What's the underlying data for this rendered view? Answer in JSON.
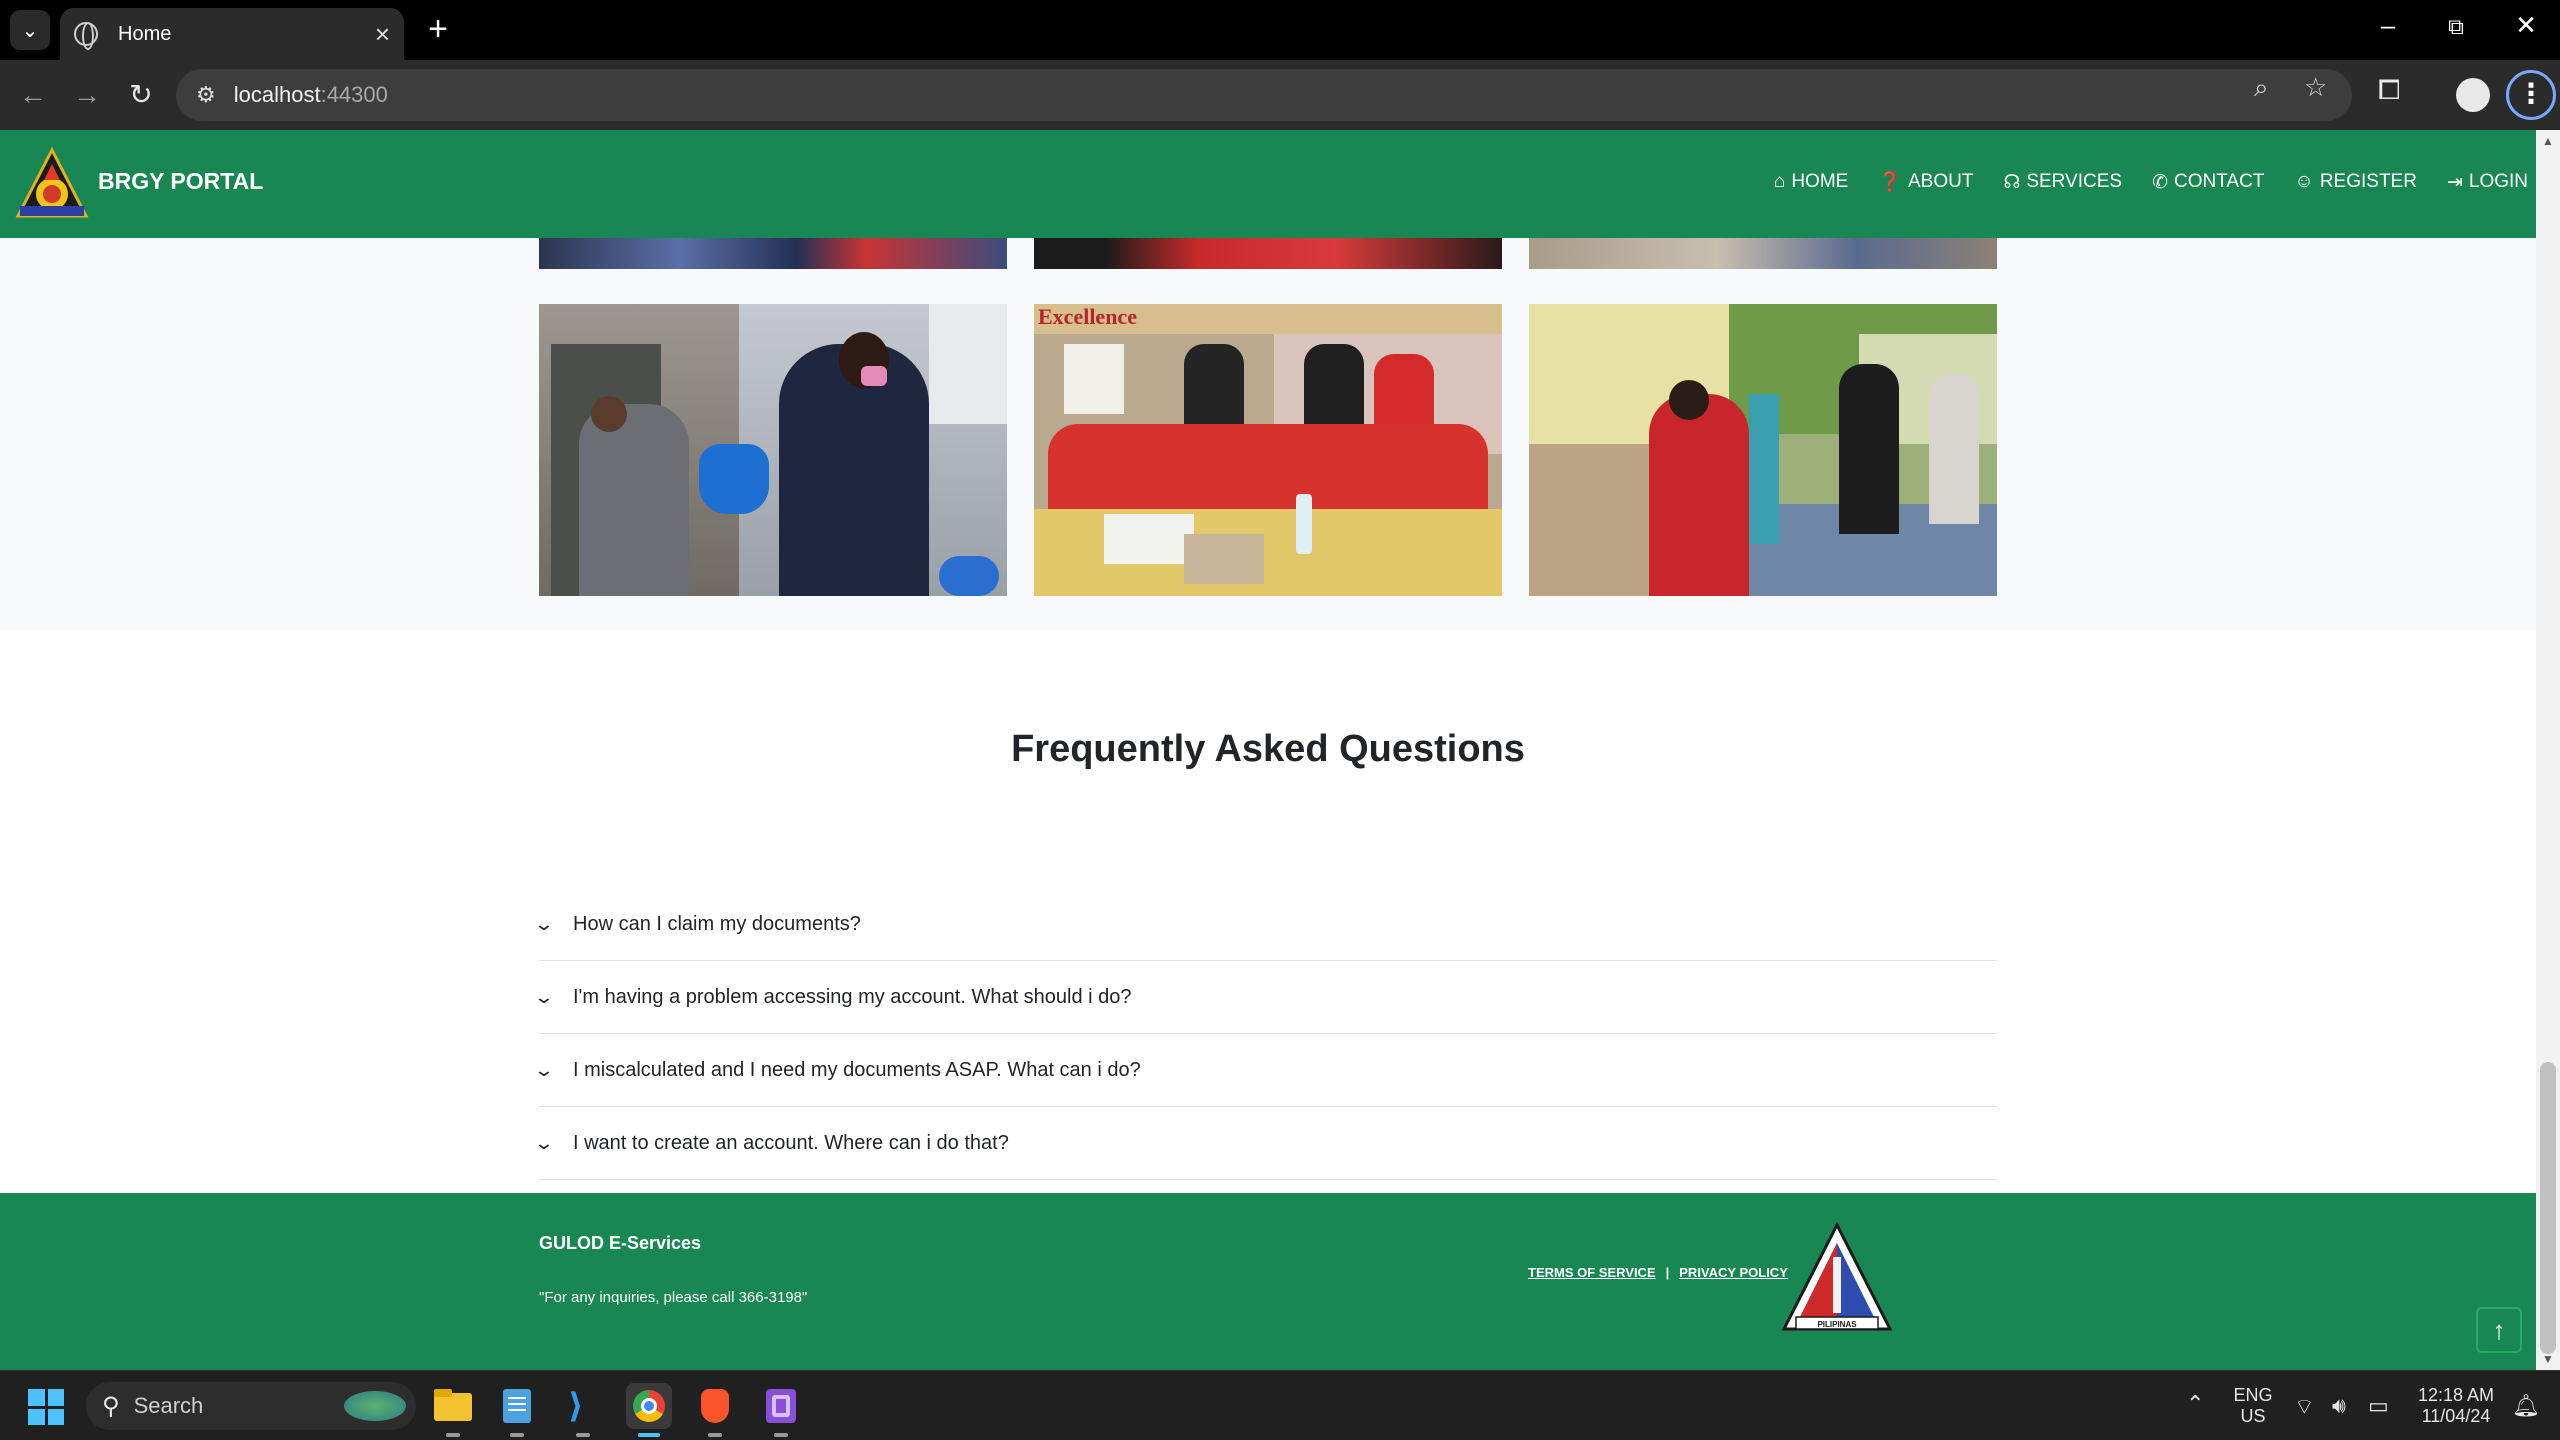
{
  "browser": {
    "tab_title": "Home",
    "url_host": "localhost",
    "url_port": ":44300"
  },
  "navbar": {
    "brand": "BRGY PORTAL",
    "items": [
      {
        "label": "HOME",
        "icon": "home-icon"
      },
      {
        "label": "ABOUT",
        "icon": "question-circle-icon"
      },
      {
        "label": "SERVICES",
        "icon": "headset-icon"
      },
      {
        "label": "CONTACT",
        "icon": "phone-icon"
      },
      {
        "label": "REGISTER",
        "icon": "user-plus-icon"
      },
      {
        "label": "LOGIN",
        "icon": "sign-in-icon"
      }
    ],
    "color": "#198754"
  },
  "faq": {
    "title": "Frequently Asked Questions",
    "items": [
      {
        "question": "How can I claim my documents?"
      },
      {
        "question": "I'm having a problem accessing my account. What should i do?"
      },
      {
        "question": "I miscalculated and I need my documents ASAP. What can i do?"
      },
      {
        "question": "I want to create an account. Where can i do that?"
      }
    ]
  },
  "footer": {
    "name": "GULOD E-Services",
    "note": "\"For any inquiries, please call 366-3198\"",
    "terms": "TERMS OF SERVICE",
    "separator": "|",
    "privacy": "PRIVACY POLICY",
    "seal_text": "PILIPINAS"
  },
  "taskbar": {
    "search_placeholder": "Search",
    "lang_line1": "ENG",
    "lang_line2": "US",
    "time": "12:18 AM",
    "date": "11/04/24"
  }
}
